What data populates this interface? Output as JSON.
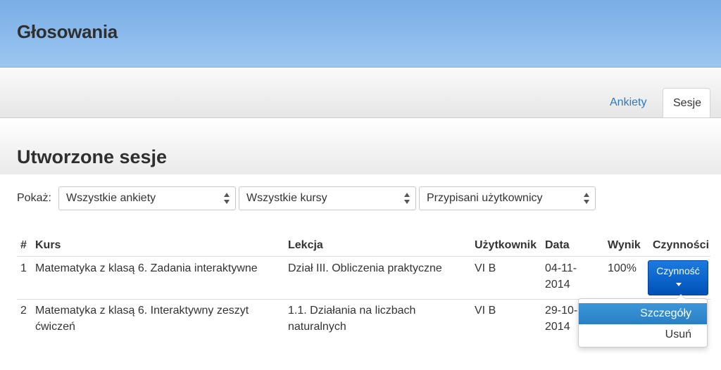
{
  "header": {
    "title": "Głosowania"
  },
  "tabs": [
    {
      "label": "Ankiety",
      "active": false
    },
    {
      "label": "Sesje",
      "active": true
    }
  ],
  "section": {
    "title": "Utworzone sesje"
  },
  "filters": {
    "label": "Pokaż:",
    "selects": [
      "Wszystkie ankiety",
      "Wszystkie kursy",
      "Przypisani użytkownicy"
    ]
  },
  "table": {
    "headers": [
      "#",
      "Kurs",
      "Lekcja",
      "Użytkownik",
      "Data",
      "Wynik",
      "Czynności"
    ],
    "rows": [
      {
        "num": "1",
        "kurs": "Matematyka z klasą 6. Zadania interaktywne",
        "lekcja": "Dział III. Obliczenia praktyczne",
        "uzytkownik": "VI B",
        "data_line1": "04-11-",
        "data_line2": "2014",
        "wynik": "100%"
      },
      {
        "num": "2",
        "kurs_line1": "Matematyka z klasą 6. Interaktywny zeszyt",
        "kurs_line2": "ćwiczeń",
        "lekcja_line1": "1.1. Działania na liczbach",
        "lekcja_line2": "naturalnych",
        "uzytkownik": "VI B",
        "data_line1": "29-10-",
        "data_line2": "2014"
      }
    ]
  },
  "actions": {
    "button_label": "Czynność",
    "menu": [
      "Szczegóły",
      "Usuń"
    ]
  },
  "colors": {
    "header_gradient_top": "#79aee6",
    "accent_link": "#2a79c2",
    "button_primary": "#0050b6",
    "menu_highlight": "#2a7fc4"
  }
}
